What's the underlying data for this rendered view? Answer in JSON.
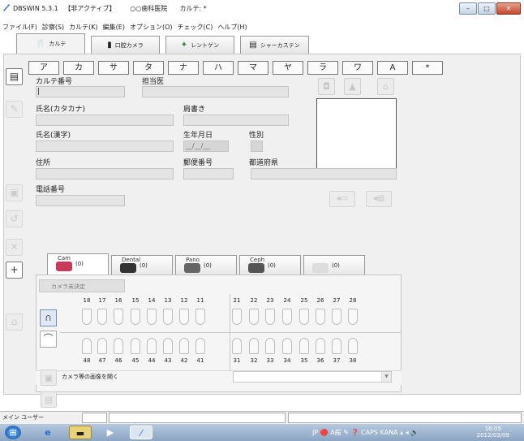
{
  "window": {
    "title": "DBSWIN 5.3.1   【非アクティブ】       ○○歯科医院      カルテ: *",
    "min": "–",
    "max": "□",
    "close": "✕"
  },
  "menu": [
    "ファイル(F)",
    "診察(S)",
    "カルテ(K)",
    "編集(E)",
    "オプション(O)",
    "チェック(C)",
    "ヘルプ(H)"
  ],
  "tabs": [
    {
      "label": "カルテ",
      "icon": "tooth-icon"
    },
    {
      "label": "口腔カメラ",
      "icon": "intraoral-camera-icon"
    },
    {
      "label": "レントゲン",
      "icon": "xray-icon"
    },
    {
      "label": "シャーカステン",
      "icon": "viewer-icon"
    }
  ],
  "kana": [
    "ア",
    "カ",
    "サ",
    "タ",
    "ナ",
    "ハ",
    "マ",
    "ヤ",
    "ラ",
    "ワ",
    "A",
    "*"
  ],
  "fields": {
    "chart_no": "カルテ番号",
    "chart_no_value": "|",
    "doctor": "担当医",
    "kana_name": "氏名(カタカナ)",
    "title": "肩書き",
    "kanji_name": "氏名(漢字)",
    "birthdate": "生年月日",
    "birthdate_value": "__/__/__",
    "sex": "性別",
    "address": "住所",
    "postal": "郵便番号",
    "prefecture": "都道府県",
    "phone": "電話番号"
  },
  "image_tabs": [
    {
      "label": "Cam",
      "count": "(0)",
      "color": "#c83a5a"
    },
    {
      "label": "Dental",
      "count": "(0)",
      "color": "#333333"
    },
    {
      "label": "Pano",
      "count": "(0)",
      "color": "#666666"
    },
    {
      "label": "Ceph",
      "count": "(0)",
      "color": "#555555"
    },
    {
      "label": "",
      "count": "(0)",
      "color": "#dddddd"
    }
  ],
  "camera_state": "カメラ未決定",
  "teeth_upper": [
    "18",
    "17",
    "16",
    "15",
    "14",
    "13",
    "12",
    "11",
    "21",
    "22",
    "23",
    "24",
    "25",
    "26",
    "27",
    "28"
  ],
  "teeth_lower": [
    "48",
    "47",
    "46",
    "45",
    "44",
    "43",
    "42",
    "41",
    "31",
    "32",
    "33",
    "34",
    "35",
    "36",
    "37",
    "38"
  ],
  "open_label": "カメラ等の画像を開く",
  "status": {
    "user": "メイン ユーザー"
  },
  "taskbar": {
    "time": "16:05",
    "date": "2012/03/09",
    "tray": "JP 🔴 A般 ✎ ❓ CAPS KANA ▴ ◂ 🔊"
  }
}
